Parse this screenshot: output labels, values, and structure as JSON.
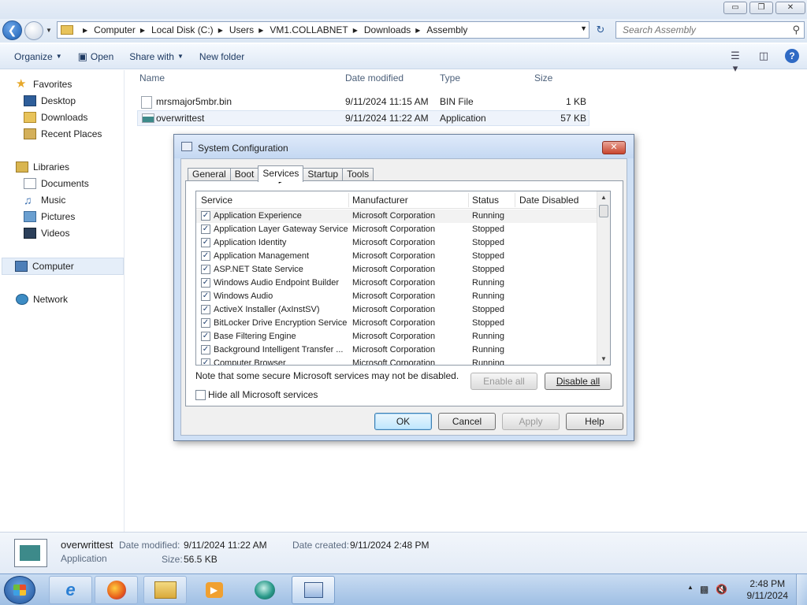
{
  "explorer": {
    "window_controls": {
      "minimize": "▭",
      "maximize": "❐",
      "close": "✕"
    },
    "breadcrumbs": [
      "Computer",
      "Local Disk (C:)",
      "Users",
      "VM1.COLLABNET",
      "Downloads",
      "Assembly"
    ],
    "search_placeholder": "Search Assembly",
    "toolbar": {
      "organize": "Organize",
      "open": "Open",
      "share_with": "Share with",
      "new_folder": "New folder"
    },
    "nav": {
      "favorites": "Favorites",
      "desktop": "Desktop",
      "downloads": "Downloads",
      "recent_places": "Recent Places",
      "libraries": "Libraries",
      "documents": "Documents",
      "music": "Music",
      "pictures": "Pictures",
      "videos": "Videos",
      "computer": "Computer",
      "network": "Network"
    },
    "columns": {
      "name": "Name",
      "date_modified": "Date modified",
      "type": "Type",
      "size": "Size"
    },
    "files": [
      {
        "name": "mrsmajor5mbr.bin",
        "date": "9/11/2024 11:15 AM",
        "type": "BIN File",
        "size": "1 KB"
      },
      {
        "name": "overwrittest",
        "date": "9/11/2024 11:22 AM",
        "type": "Application",
        "size": "57 KB"
      }
    ],
    "details": {
      "name": "overwrittest",
      "type": "Application",
      "date_modified_label": "Date modified:",
      "date_modified": "9/11/2024 11:22 AM",
      "date_created_label": "Date created:",
      "date_created": "9/11/2024 2:48 PM",
      "size_label": "Size:",
      "size": "56.5 KB"
    }
  },
  "dialog": {
    "title": "System Configuration",
    "close": "✕",
    "tabs": [
      "General",
      "Boot",
      "Services",
      "Startup",
      "Tools"
    ],
    "active_tab": "Services",
    "columns": {
      "service": "Service",
      "manufacturer": "Manufacturer",
      "status": "Status",
      "date_disabled": "Date Disabled"
    },
    "services": [
      {
        "name": "Application Experience",
        "manufacturer": "Microsoft Corporation",
        "status": "Running",
        "checked": true
      },
      {
        "name": "Application Layer Gateway Service",
        "manufacturer": "Microsoft Corporation",
        "status": "Stopped",
        "checked": true
      },
      {
        "name": "Application Identity",
        "manufacturer": "Microsoft Corporation",
        "status": "Stopped",
        "checked": true
      },
      {
        "name": "Application Management",
        "manufacturer": "Microsoft Corporation",
        "status": "Stopped",
        "checked": true
      },
      {
        "name": "ASP.NET State Service",
        "manufacturer": "Microsoft Corporation",
        "status": "Stopped",
        "checked": true
      },
      {
        "name": "Windows Audio Endpoint Builder",
        "manufacturer": "Microsoft Corporation",
        "status": "Running",
        "checked": true
      },
      {
        "name": "Windows Audio",
        "manufacturer": "Microsoft Corporation",
        "status": "Running",
        "checked": true
      },
      {
        "name": "ActiveX Installer (AxInstSV)",
        "manufacturer": "Microsoft Corporation",
        "status": "Stopped",
        "checked": true
      },
      {
        "name": "BitLocker Drive Encryption Service",
        "manufacturer": "Microsoft Corporation",
        "status": "Stopped",
        "checked": true
      },
      {
        "name": "Base Filtering Engine",
        "manufacturer": "Microsoft Corporation",
        "status": "Running",
        "checked": true
      },
      {
        "name": "Background Intelligent Transfer ...",
        "manufacturer": "Microsoft Corporation",
        "status": "Running",
        "checked": true
      },
      {
        "name": "Computer Browser",
        "manufacturer": "Microsoft Corporation",
        "status": "Running",
        "checked": true
      }
    ],
    "note": "Note that some secure Microsoft services may not be disabled.",
    "enable_all": "Enable all",
    "disable_all": "Disable all",
    "hide_ms": "Hide all Microsoft services",
    "ok": "OK",
    "cancel": "Cancel",
    "apply": "Apply",
    "help": "Help"
  },
  "taskbar": {
    "time": "2:48 PM",
    "date": "9/11/2024"
  }
}
